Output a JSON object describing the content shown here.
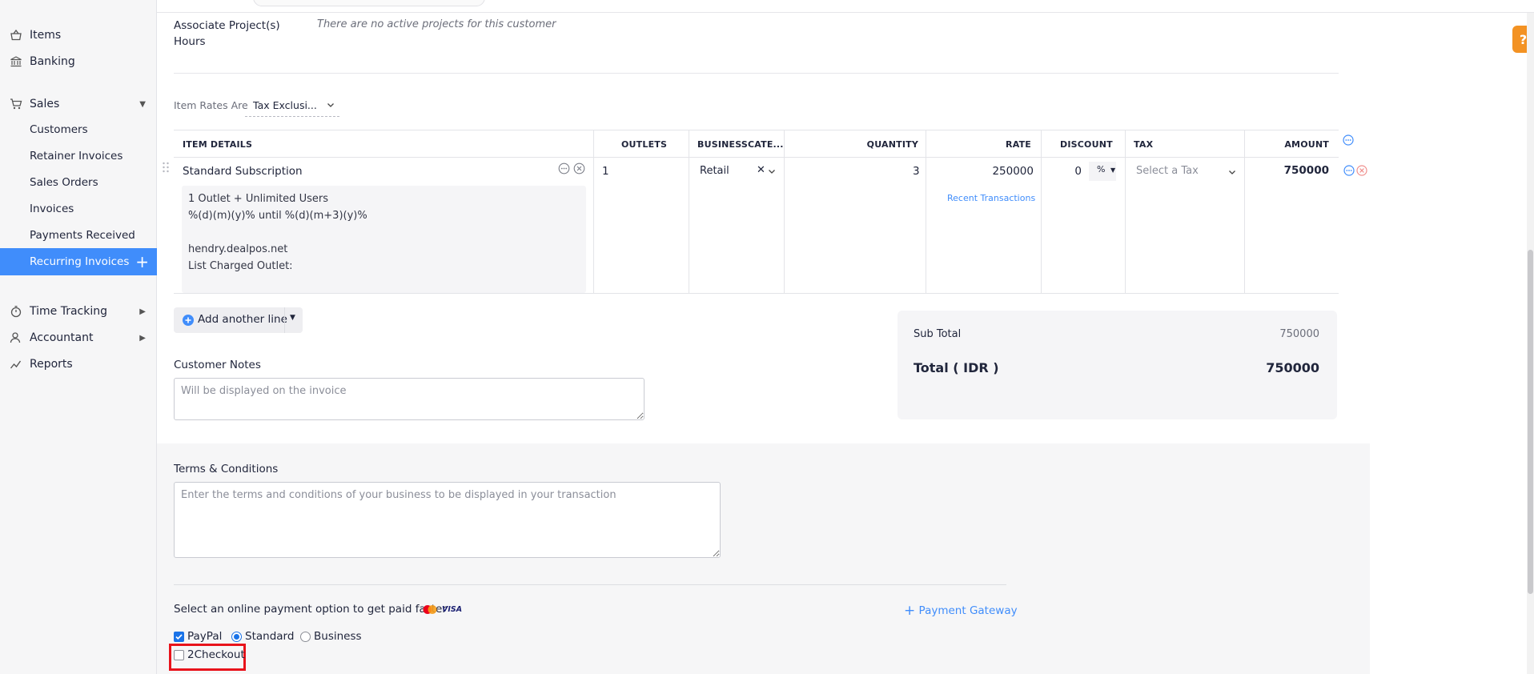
{
  "sidebar": {
    "items": [
      {
        "label": "Items",
        "icon": "basket-icon"
      },
      {
        "label": "Banking",
        "icon": "bank-icon"
      },
      {
        "label": "Sales",
        "icon": "cart-icon"
      }
    ],
    "sales_sub": [
      {
        "label": "Customers"
      },
      {
        "label": "Retainer Invoices"
      },
      {
        "label": "Sales Orders"
      },
      {
        "label": "Invoices"
      },
      {
        "label": "Payments Received"
      },
      {
        "label": "Recurring Invoices"
      }
    ],
    "bottom_items": [
      {
        "label": "Time Tracking",
        "icon": "stopwatch-icon"
      },
      {
        "label": "Accountant",
        "icon": "accountant-icon"
      },
      {
        "label": "Reports",
        "icon": "reports-icon"
      }
    ]
  },
  "form": {
    "associate_projects_label": "Associate Project(s)",
    "associate_projects_label2": "Hours",
    "associate_projects_value": "There are no active projects for this customer",
    "item_rates_label": "Item Rates Are",
    "item_rates_value": "Tax Exclusi..."
  },
  "table": {
    "headers": {
      "item_details": "ITEM DETAILS",
      "outlets": "OUTLETS",
      "business_category": "BUSINESSCATE...",
      "quantity": "QUANTITY",
      "rate": "RATE",
      "discount": "DISCOUNT",
      "tax": "TAX",
      "amount": "AMOUNT"
    },
    "row": {
      "item_name": "Standard Subscription",
      "description": [
        "1 Outlet + Unlimited Users",
        "%(d)(m)(y)% until %(d)(m+3)(y)%",
        "",
        "hendry.dealpos.net",
        "List Charged Outlet:"
      ],
      "outlets": "1",
      "business_category": "Retail",
      "quantity": "3",
      "rate": "250000",
      "recent_transactions": "Recent Transactions",
      "discount": "0",
      "discount_unit": "%",
      "tax_placeholder": "Select a Tax",
      "amount": "750000"
    }
  },
  "add_line": {
    "label": "Add another line"
  },
  "customer_notes": {
    "label": "Customer Notes",
    "placeholder": "Will be displayed on the invoice"
  },
  "totals": {
    "sub_total_label": "Sub Total",
    "sub_total_value": "750000",
    "total_label": "Total ( IDR )",
    "total_value": "750000"
  },
  "terms": {
    "label": "Terms & Conditions",
    "placeholder": "Enter the terms and conditions of your business to be displayed in your transaction"
  },
  "payment": {
    "prompt": "Select an online payment option to get paid faster",
    "visa_text": "VISA",
    "gateway_link": "Payment Gateway",
    "paypal_label": "PayPal",
    "standard_label": "Standard",
    "business_label": "Business",
    "twocheckout_label": "2Checkout"
  },
  "help": {
    "label": "?"
  },
  "colors": {
    "accent": "#408dfb",
    "highlight": "#e8131b",
    "help": "#f39223"
  }
}
